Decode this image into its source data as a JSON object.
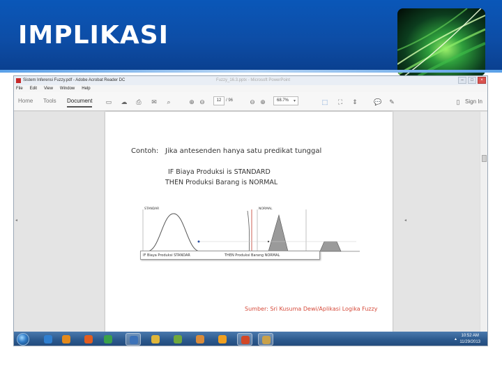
{
  "slide": {
    "title": "IMPLIKASI"
  },
  "app": {
    "window_title": "Sistem Inferensi Fuzzy.pdf - Adobe Acrobat Reader DC",
    "background_window_title": "Fuzzy_16.3.pptx - Microsoft PowerPoint",
    "window_buttons": [
      "–",
      "□",
      "×"
    ],
    "menu": [
      "File",
      "Edit",
      "View",
      "Window",
      "Help"
    ],
    "tabs": [
      "Home",
      "Tools",
      "Document"
    ],
    "active_tab": "Document",
    "page_current": "12",
    "page_total": "/ 96",
    "zoom": "68.7%",
    "sign_in": "Sign In",
    "icons": [
      "save-icon",
      "cloud-upload-icon",
      "print-icon",
      "mail-icon",
      "search-icon",
      "page-up-icon",
      "page-down-icon",
      "zoom-out-icon",
      "zoom-in-icon",
      "select-icon",
      "fit-page-icon",
      "scroll-mode-icon",
      "comment-icon",
      "pen-icon",
      "phone-icon"
    ]
  },
  "document": {
    "example_label": "Contoh:",
    "example_text": "Jika antesenden hanya satu predikat tunggal",
    "rule_if": "IF Biaya Produksi is STANDARD",
    "rule_then": "THEN Produksi Barang is NORMAL",
    "graph_label_left": "STANDAR",
    "graph_label_right": "NORMAL",
    "caption_if": "IF Biaya Produksi STANDAR",
    "caption_then": "THEN Produksi Barang NORMAL",
    "source": "Sumber: Sri Kusuma Dewi/Aplikasi Logika Fuzzy"
  },
  "taskbar": {
    "clock_time": "10:52 AM",
    "clock_date": "11/29/2013",
    "apps": [
      {
        "name": "ie",
        "color": "#2f7fd0"
      },
      {
        "name": "media-player",
        "color": "#e38a1c"
      },
      {
        "name": "firefox",
        "color": "#e25d1f"
      },
      {
        "name": "chrome",
        "color": "#3aa14a"
      },
      {
        "name": "outlook",
        "color": "#3c72b8"
      },
      {
        "name": "explorer",
        "color": "#e0b63a"
      },
      {
        "name": "utility",
        "color": "#6fa83c"
      },
      {
        "name": "photos",
        "color": "#d98b3a"
      },
      {
        "name": "app-orange",
        "color": "#f0a020"
      },
      {
        "name": "powerpoint",
        "color": "#d24726"
      },
      {
        "name": "camera",
        "color": "#c9a14a"
      }
    ]
  }
}
